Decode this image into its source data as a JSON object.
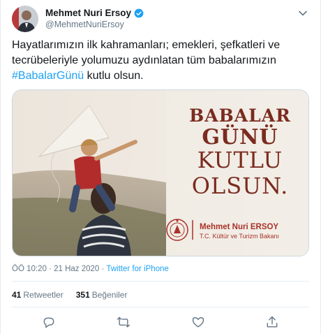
{
  "author": {
    "name": "Mehmet Nuri Ersoy",
    "handle": "@MehmetNuriErsoy",
    "verified": true,
    "avatar_icon": "avatar-portrait"
  },
  "tweet": {
    "text_line1": "Hayatlarımızın ilk kahramanları; emekleri, şefkatleri ve",
    "text_line2": "tecrübeleriyle yolumuzu aydınlatan tüm babalarımızın",
    "hashtag": "#BabalarGünü",
    "text_after_hashtag": " kutlu olsun."
  },
  "image": {
    "line1": "BABALAR",
    "line2": "GÜNÜ",
    "line3": "KUTLU",
    "line4": "OLSUN.",
    "signature_name": "Mehmet Nuri ERSOY",
    "signature_title": "T.C. Kültür ve Turizm Bakanı",
    "text_color": "#7b2b1f"
  },
  "meta": {
    "time": "ÖÖ 10:20",
    "date": "21 Haz 2020",
    "separator": " · ",
    "source": "Twitter for iPhone"
  },
  "stats": {
    "retweets_count": "41",
    "retweets_label": "Retweetler",
    "likes_count": "351",
    "likes_label": "Beğeniler"
  },
  "actions": [
    "reply-icon",
    "retweet-icon",
    "like-icon",
    "share-icon"
  ],
  "colors": {
    "accent": "#1da1f2",
    "muted": "#657786"
  }
}
